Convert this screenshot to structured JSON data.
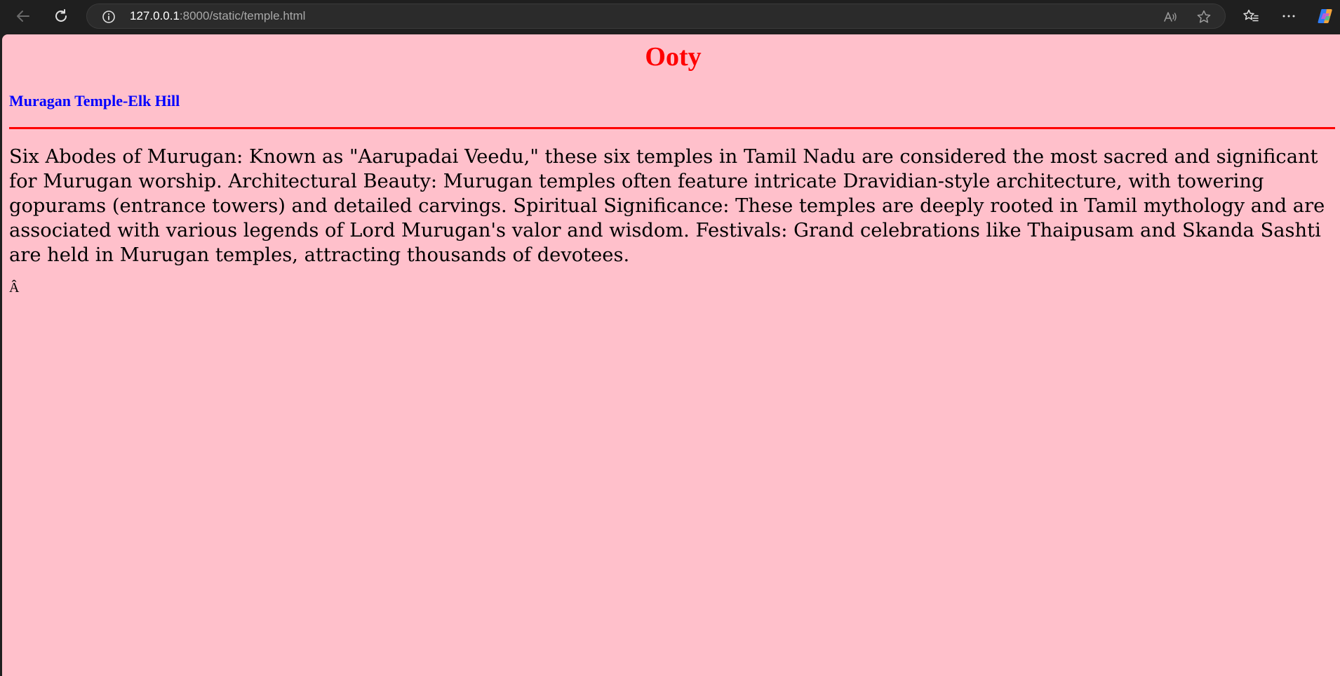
{
  "browser": {
    "url_host": "127.0.0.1",
    "url_rest": ":8000/static/temple.html",
    "icons": {
      "back": "arrow-left-icon",
      "reload": "reload-icon",
      "info": "info-icon",
      "read_aloud": "read-aloud-icon",
      "favorite": "star-icon",
      "favorites": "favorites-icon",
      "more": "more-icon",
      "copilot": "copilot-icon"
    }
  },
  "page": {
    "title": "Ooty",
    "subtitle": "Muragan Temple-Elk Hill",
    "paragraph": "Six Abodes of Murugan: Known as \"Aarupadai Veedu,\" these six temples in Tamil Nadu are considered the most sacred and significant for Murugan worship. Architectural Beauty: Murugan temples often feature intricate Dravidian-style architecture, with towering gopurams (entrance towers) and detailed carvings. Spiritual Significance: These temples are deeply rooted in Tamil mythology and are associated with various legends of Lord Murugan's valor and wisdom. Festivals: Grand celebrations like Thaipusam and Skanda Sashti are held in Murugan temples, attracting thousands of devotees.",
    "stray_char": "Â"
  },
  "colors": {
    "page_background": "#ffc0cb",
    "title": "#ff0000",
    "subtitle": "#0000ff",
    "divider": "#ff0000"
  }
}
